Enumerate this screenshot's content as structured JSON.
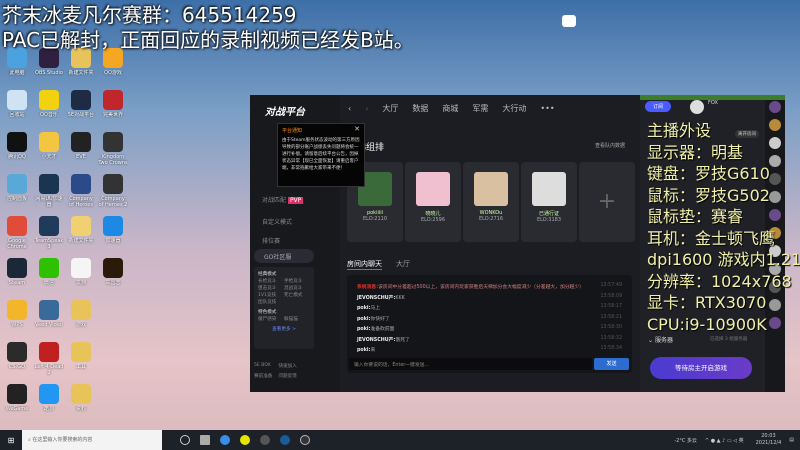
{
  "overlay": {
    "line1": "芥末冰麦凡尔赛群：645514259",
    "line2": "PAC已解封，正面回应的录制视频已经发B站。"
  },
  "desktop_icons": [
    {
      "label": "此电脑",
      "color": "#4aa3df",
      "col": 0,
      "row": 0
    },
    {
      "label": "OBS Studio",
      "color": "#302040",
      "col": 1,
      "row": 0
    },
    {
      "label": "新建文件夹",
      "color": "#e8c35a",
      "col": 2,
      "row": 0
    },
    {
      "label": "QQ游戏",
      "color": "#f5a623",
      "col": 3,
      "row": 0
    },
    {
      "label": "回收站",
      "color": "#cfe3f2",
      "col": 0,
      "row": 1
    },
    {
      "label": "QQ音乐",
      "color": "#f2d20f",
      "col": 1,
      "row": 1
    },
    {
      "label": "5E对战平台",
      "color": "#1f2a44",
      "col": 2,
      "row": 1
    },
    {
      "label": "完美世界",
      "color": "#c0262c",
      "col": 3,
      "row": 1
    },
    {
      "label": "腾讯QQ",
      "color": "#111",
      "col": 0,
      "row": 2
    },
    {
      "label": "小天才",
      "color": "#f3c540",
      "col": 1,
      "row": 2
    },
    {
      "label": "EVE",
      "color": "#222",
      "col": 2,
      "row": 2
    },
    {
      "label": "Kingdom Two Crowns",
      "color": "#333",
      "col": 3,
      "row": 2
    },
    {
      "label": "控制面板",
      "color": "#58a8d8",
      "col": 0,
      "row": 3
    },
    {
      "label": "网易UU加速器",
      "color": "#1a3550",
      "col": 1,
      "row": 3
    },
    {
      "label": "Company of Heroes",
      "color": "#2a4a8a",
      "col": 2,
      "row": 3
    },
    {
      "label": "Company of Heroes 2",
      "color": "#333",
      "col": 3,
      "row": 3
    },
    {
      "label": "Google Chrome",
      "color": "#e04b3a",
      "col": 0,
      "row": 4
    },
    {
      "label": "TeamSpeak 3",
      "color": "#1f3a5a",
      "col": 1,
      "row": 4
    },
    {
      "label": "新建文件夹",
      "color": "#f0d070",
      "col": 2,
      "row": 4
    },
    {
      "label": "加速器",
      "color": "#1e88e5",
      "col": 3,
      "row": 4
    },
    {
      "label": "Steam",
      "color": "#1b2838",
      "col": 0,
      "row": 5
    },
    {
      "label": "微信",
      "color": "#2dc100",
      "col": 1,
      "row": 5
    },
    {
      "label": "文档",
      "color": "#f5f5f5",
      "col": 2,
      "row": 5
    },
    {
      "label": "三国志",
      "color": "#2a1a0a",
      "col": 3,
      "row": 5
    },
    {
      "label": "WPS",
      "color": "#f3b52a",
      "col": 0,
      "row": 6
    },
    {
      "label": "Veed Video",
      "color": "#3a6a9a",
      "col": 1,
      "row": 6
    },
    {
      "label": "游戏",
      "color": "#e8c35a",
      "col": 2,
      "row": 6
    },
    {
      "label": "CS:GO",
      "color": "#2b2b2b",
      "col": 0,
      "row": 7
    },
    {
      "label": "Left 4 Dead 2",
      "color": "#c02020",
      "col": 1,
      "row": 7
    },
    {
      "label": "工具",
      "color": "#e8c35a",
      "col": 2,
      "row": 7
    },
    {
      "label": "WeGame",
      "color": "#222",
      "col": 0,
      "row": 8
    },
    {
      "label": "酷狗",
      "color": "#2196f3",
      "col": 1,
      "row": 8
    },
    {
      "label": "资料",
      "color": "#e8c35a",
      "col": 2,
      "row": 8
    }
  ],
  "app": {
    "logo": "对战平台",
    "nav": [
      "大厅",
      "数据",
      "商城",
      "军需",
      "大行动"
    ],
    "more": "•••",
    "notice": {
      "title": "平台通知",
      "body": "由于Steam服务状态波动的第三方原因导致的部分账户战绩丢失问题将会统一进行补偿。请留意后续平台公告，因掉状态异常【现已全面恢复】请重启客户端，非常抱歉给大家带来不便！"
    },
    "sidebar": [
      {
        "label": "对战匹配",
        "badge": "PVP"
      },
      {
        "label": "自定义模式"
      },
      {
        "label": "排位赛"
      }
    ],
    "go": {
      "label": "GO社区服"
    },
    "classic": {
      "title": "经典模式",
      "items": [
        "长枪竞斗",
        "手枪竞斗",
        "狙击竞斗",
        "混战竞斗",
        "1V1竞技",
        "死亡模式",
        "团队竞技"
      ]
    },
    "special": {
      "title": "特色模式",
      "items": [
        "僵尸感染",
        "躲猫猫"
      ]
    },
    "more_modes": "查看更多 >",
    "bottom": [
      "5E BOX",
      "快速加入",
      "赛前准备",
      "问题反馈"
    ],
    "section_title": "天梯组排",
    "team_data": "查看队内数据",
    "players": [
      {
        "name": "pokiiiii",
        "elo": "ELO:2110",
        "color": "#3a6a3a"
      },
      {
        "name": "晓晓儿",
        "elo": "ELO:2596",
        "color": "#f0c0d0"
      },
      {
        "name": "WONKOu",
        "elo": "ELO:2716",
        "color": "#d8c0a0"
      },
      {
        "name": "已通行证",
        "elo": "ELO:3183",
        "color": "#ddd"
      }
    ],
    "chat_tabs": [
      "房间内聊天",
      "大厅"
    ],
    "chat": [
      {
        "user": "系统消息:",
        "text": "该房间中分差超过500以上，该房间内玩家获胜后天梯加分会大幅度减少（分差越大，加分越少）",
        "time": "13:57:49",
        "system": true
      },
      {
        "user": "JEVONSCHU产:",
        "text": "KKK",
        "time": "13:58:09"
      },
      {
        "user": "poki:",
        "text": "马上",
        "time": "13:58:17"
      },
      {
        "user": "poki:",
        "text": "你快好了",
        "time": "13:58:21"
      },
      {
        "user": "poki:",
        "text": "准备砍前面",
        "time": "13:58:30"
      },
      {
        "user": "JEVONSCHU产:",
        "text": "饿死了",
        "time": "13:58:32"
      },
      {
        "user": "poki:",
        "text": "来",
        "time": "13:58:34"
      }
    ],
    "chat_placeholder": "输入你要说的话，Enter一键发送...",
    "send": "发送",
    "vip": "订阅",
    "user_name": "FOX",
    "open_room": "离开房间",
    "server": "服务器",
    "server_info": "已选择 3 组服务器",
    "wait_button": "等待房主开启游戏"
  },
  "spec": [
    "主播外设",
    "显示器：明基",
    "键盘：罗技G610",
    "鼠标：罗技G502",
    "鼠标垫：赛睿",
    "耳机：金士顿飞鹰",
    "dpi1600 游戏内1.21",
    "分辨率：1024x768",
    "显卡：RTX3070",
    "CPU:i9-10900K"
  ],
  "taskbar": {
    "search": "在这里输入你要搜索的内容",
    "weather": "-2°C 多云",
    "time": "20:03",
    "date": "2021/12/4"
  }
}
